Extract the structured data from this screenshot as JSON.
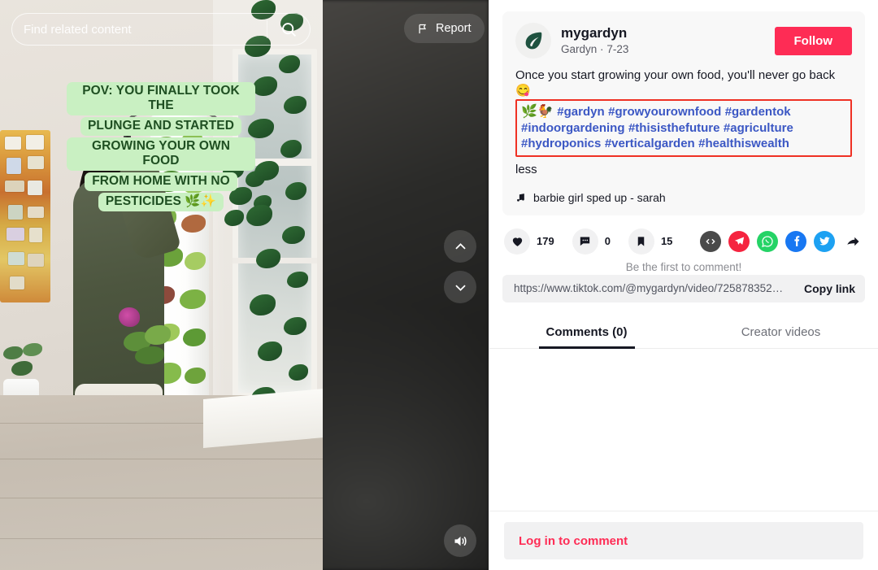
{
  "video": {
    "search": {
      "placeholder": "Find related content",
      "icon": "search-icon"
    },
    "report": {
      "label": "Report",
      "icon": "flag-icon"
    },
    "nav": {
      "up_icon": "chevron-up-icon",
      "down_icon": "chevron-down-icon"
    },
    "volume": {
      "icon": "volume-on-icon"
    },
    "caption_lines": [
      "POV: YOU FINALLY TOOK THE",
      "PLUNGE AND STARTED",
      "GROWING YOUR OWN FOOD",
      "FROM HOME WITH NO",
      "PESTICIDES 🌿✨"
    ],
    "scene_description": "Woman in olive shirt and white shorts tending a white vertical hydroponic garden tower full of lettuce in a bright room with a window and hanging pothos plants"
  },
  "post": {
    "author": {
      "username": "mygardyn",
      "display_name": "Gardyn",
      "date": "7-23",
      "meta_separator": "·",
      "avatar_icon": "leaf-logo-icon",
      "avatar_color": "#1f5240"
    },
    "follow_label": "Follow",
    "follow_color": "#fe2c55",
    "description": "Once you start growing your own food, you'll never go back 😋",
    "hashtag_prefix": "🌿🐓",
    "hashtags": [
      "#gardyn",
      "#growyourownfood",
      "#gardentok",
      "#indoorgardening",
      "#thisisthefuture",
      "#agriculture",
      "#hydroponics",
      "#verticalgarden",
      "#healthiswealth"
    ],
    "hashtag_color": "#3b57c4",
    "highlight_color": "#ef3124",
    "less_label": "less",
    "music": {
      "icon": "music-note-icon",
      "title": "barbie girl sped up - sarah"
    }
  },
  "stats": {
    "likes": {
      "icon": "heart-icon",
      "count": "179"
    },
    "comments": {
      "icon": "comment-icon",
      "count": "0"
    },
    "bookmarks": {
      "icon": "bookmark-icon",
      "count": "15"
    }
  },
  "share": {
    "items": [
      {
        "name": "embed-icon",
        "label": "Embed",
        "color": "#4a4a4a"
      },
      {
        "name": "telegram-icon",
        "label": "Telegram",
        "color": "#f5243f"
      },
      {
        "name": "whatsapp-icon",
        "label": "WhatsApp",
        "color": "#25d366"
      },
      {
        "name": "facebook-icon",
        "label": "Facebook",
        "color": "#1877f2"
      },
      {
        "name": "twitter-icon",
        "label": "Twitter",
        "color": "#1da1f2"
      },
      {
        "name": "share-arrow-icon",
        "label": "Share",
        "color": "#161823"
      }
    ]
  },
  "link": {
    "prompt": "Be the first to comment!",
    "url": "https://www.tiktok.com/@mygardyn/video/725878352…",
    "copy_label": "Copy link"
  },
  "tabs": [
    {
      "label": "Comments (0)",
      "active": true
    },
    {
      "label": "Creator videos",
      "active": false
    }
  ],
  "footer": {
    "login_label": "Log in to comment"
  }
}
